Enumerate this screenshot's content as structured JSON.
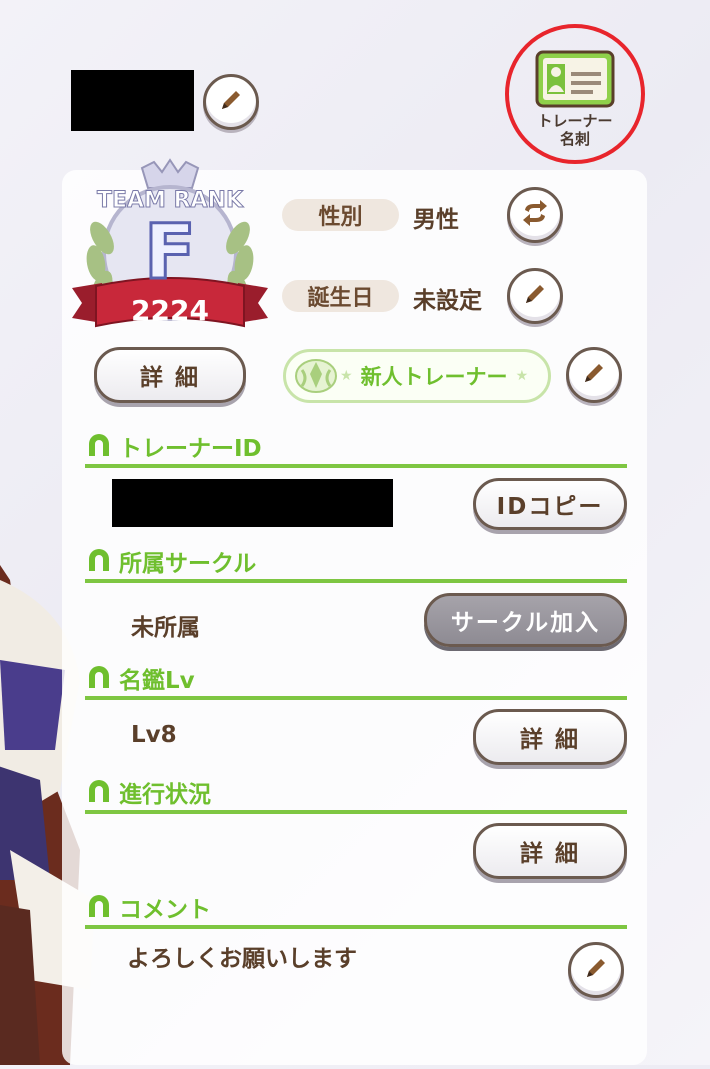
{
  "header": {
    "card_button_label_line1": "トレーナー",
    "card_button_label_line2": "名刺"
  },
  "rank": {
    "title": "TEAM RANK",
    "letter": "F",
    "score": "2224"
  },
  "profile": {
    "gender_label": "性別",
    "gender_value": "男性",
    "birthday_label": "誕生日",
    "birthday_value": "未設定",
    "detail_label": "詳 細",
    "title_name": "新人トレーナー"
  },
  "sections": {
    "trainer_id": {
      "title": "トレーナーID",
      "copy_label": "IDコピー"
    },
    "circle": {
      "title": "所属サークル",
      "value": "未所属",
      "join_label": "サークル加入"
    },
    "meikan": {
      "title": "名鑑Lv",
      "value": "Lv8",
      "detail_label": "詳 細"
    },
    "progress": {
      "title": "進行状況",
      "detail_label": "詳 細"
    },
    "comment": {
      "title": "コメント",
      "value": "よろしくお願いします"
    }
  },
  "colors": {
    "accent_green": "#7ec642",
    "brown_text": "#5a3f2a",
    "highlight_red": "#e8252c",
    "ribbon_red": "#c8283a"
  },
  "icons": [
    "pencil-icon",
    "swap-icon",
    "horseshoe-icon",
    "trainer-card-icon",
    "laurel-wreath-icon",
    "title-emblem-icon"
  ]
}
